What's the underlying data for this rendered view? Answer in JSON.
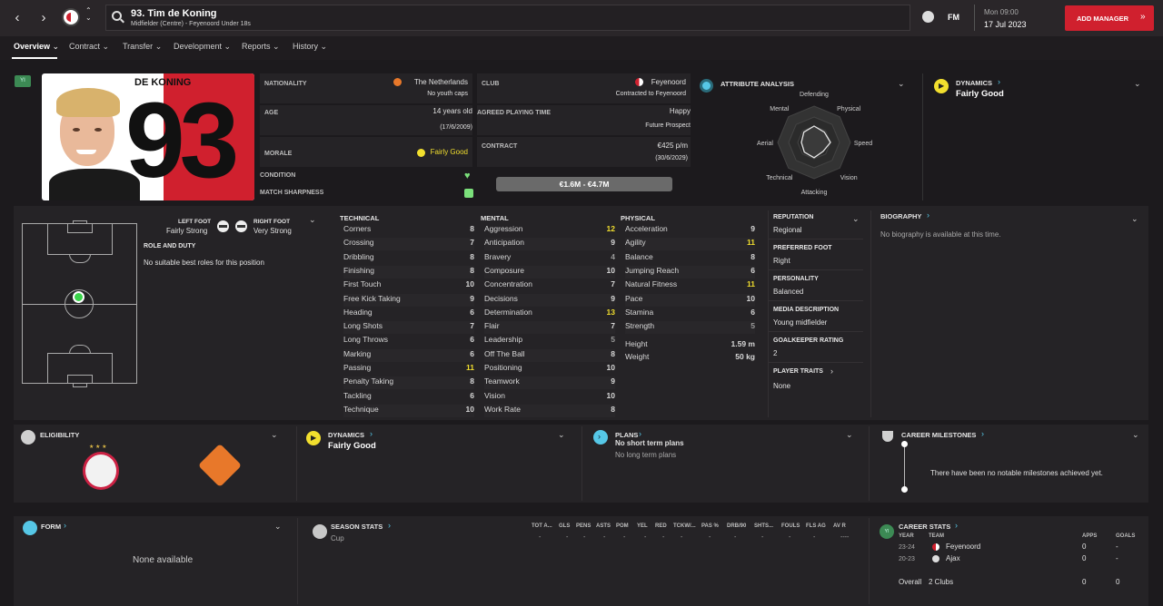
{
  "header": {
    "title": "93. Tim de Koning",
    "subtitle": "Midfielder (Centre) - Feyenoord Under 18s",
    "fm_label": "FM",
    "time": "Mon 09:00",
    "date": "17 Jul 2023",
    "add_manager": "ADD MANAGER"
  },
  "tabs": [
    "Overview",
    "Contract",
    "Transfer",
    "Development",
    "Reports",
    "History"
  ],
  "player": {
    "badge": "YI",
    "shirt_name": "DE KONING",
    "shirt_number": "93",
    "nationality_label": "NATIONALITY",
    "nationality": "The Netherlands",
    "youth_caps": "No youth caps",
    "club_label": "CLUB",
    "club": "Feyenoord",
    "club_status": "Contracted to Feyenoord",
    "age_label": "AGE",
    "age": "14 years old",
    "dob": "(17/6/2009)",
    "apt_label": "AGREED PLAYING TIME",
    "apt_status": "Happy",
    "apt_value": "Future Prospect",
    "morale_label": "MORALE",
    "morale": "Fairly Good",
    "contract_label": "CONTRACT",
    "wage": "€425 p/m",
    "contract_end": "(30/6/2029)",
    "condition_label": "CONDITION",
    "sharpness_label": "MATCH SHARPNESS",
    "value": "€1.6M - €4.7M"
  },
  "attr_analysis": {
    "title": "ATTRIBUTE ANALYSIS",
    "labels": [
      "Defending",
      "Physical",
      "Speed",
      "Vision",
      "Attacking",
      "Technical",
      "Aerial",
      "Mental"
    ],
    "values": [
      0.45,
      0.4,
      0.45,
      0.35,
      0.42,
      0.38,
      0.35,
      0.4
    ]
  },
  "dynamics_top": {
    "label": "DYNAMICS",
    "value": "Fairly Good"
  },
  "feet": {
    "left_label": "LEFT FOOT",
    "left": "Fairly Strong",
    "right_label": "RIGHT FOOT",
    "right": "Very Strong",
    "role_label": "ROLE AND DUTY",
    "role_text": "No suitable best roles for this position"
  },
  "technical": {
    "title": "TECHNICAL",
    "rows": [
      {
        "n": "Corners",
        "v": "8"
      },
      {
        "n": "Crossing",
        "v": "7"
      },
      {
        "n": "Dribbling",
        "v": "8"
      },
      {
        "n": "Finishing",
        "v": "8"
      },
      {
        "n": "First Touch",
        "v": "10"
      },
      {
        "n": "Free Kick Taking",
        "v": "9"
      },
      {
        "n": "Heading",
        "v": "6"
      },
      {
        "n": "Long Shots",
        "v": "7"
      },
      {
        "n": "Long Throws",
        "v": "6"
      },
      {
        "n": "Marking",
        "v": "6"
      },
      {
        "n": "Passing",
        "v": "11"
      },
      {
        "n": "Penalty Taking",
        "v": "8"
      },
      {
        "n": "Tackling",
        "v": "6"
      },
      {
        "n": "Technique",
        "v": "10"
      }
    ]
  },
  "mental": {
    "title": "MENTAL",
    "rows": [
      {
        "n": "Aggression",
        "v": "12"
      },
      {
        "n": "Anticipation",
        "v": "9"
      },
      {
        "n": "Bravery",
        "v": "4"
      },
      {
        "n": "Composure",
        "v": "10"
      },
      {
        "n": "Concentration",
        "v": "7"
      },
      {
        "n": "Decisions",
        "v": "9"
      },
      {
        "n": "Determination",
        "v": "13"
      },
      {
        "n": "Flair",
        "v": "7"
      },
      {
        "n": "Leadership",
        "v": "5"
      },
      {
        "n": "Off The Ball",
        "v": "8"
      },
      {
        "n": "Positioning",
        "v": "10"
      },
      {
        "n": "Teamwork",
        "v": "9"
      },
      {
        "n": "Vision",
        "v": "10"
      },
      {
        "n": "Work Rate",
        "v": "8"
      }
    ]
  },
  "physical": {
    "title": "PHYSICAL",
    "rows": [
      {
        "n": "Acceleration",
        "v": "9"
      },
      {
        "n": "Agility",
        "v": "11"
      },
      {
        "n": "Balance",
        "v": "8"
      },
      {
        "n": "Jumping Reach",
        "v": "6"
      },
      {
        "n": "Natural Fitness",
        "v": "11"
      },
      {
        "n": "Pace",
        "v": "10"
      },
      {
        "n": "Stamina",
        "v": "6"
      },
      {
        "n": "Strength",
        "v": "5"
      }
    ],
    "height_label": "Height",
    "height": "1.59 m",
    "weight_label": "Weight",
    "weight": "50 kg"
  },
  "info": {
    "reputation_label": "REPUTATION",
    "reputation": "Regional",
    "foot_label": "PREFERRED FOOT",
    "foot": "Right",
    "personality_label": "PERSONALITY",
    "personality": "Balanced",
    "media_label": "MEDIA DESCRIPTION",
    "media": "Young midfielder",
    "gk_label": "GOALKEEPER RATING",
    "gk": "2",
    "traits_label": "PLAYER TRAITS",
    "traits": "None"
  },
  "biography": {
    "label": "BIOGRAPHY",
    "text": "No biography is available at this time."
  },
  "eligibility": {
    "label": "ELIGIBILITY"
  },
  "dynamics_bottom": {
    "label": "DYNAMICS",
    "value": "Fairly Good"
  },
  "plans": {
    "label": "PLANS",
    "short": "No short term plans",
    "long": "No long term plans"
  },
  "milestones": {
    "label": "CAREER MILESTONES",
    "text": "There have been no notable milestones achieved yet."
  },
  "form": {
    "label": "FORM",
    "text": "None available"
  },
  "season_stats": {
    "label": "SEASON STATS",
    "competition": "Cup",
    "cols": [
      "TOT A...",
      "GLS",
      "PENS",
      "ASTS",
      "POM",
      "YEL",
      "RED",
      "TCKW/...",
      "PAS %",
      "DRB/90",
      "SHTS...",
      "FOULS",
      "FLS AG",
      "AV R"
    ],
    "vals": [
      "-",
      "-",
      "-",
      "-",
      "-",
      "-",
      "-",
      "-",
      "-",
      "-",
      "-",
      "-",
      "-",
      "----"
    ]
  },
  "career_stats": {
    "label": "CAREER STATS",
    "year_h": "YEAR",
    "team_h": "TEAM",
    "apps_h": "APPS",
    "goals_h": "GOALS",
    "rows": [
      {
        "year": "23-24",
        "team": "Feyenoord",
        "apps": "0",
        "goals": "-"
      },
      {
        "year": "20-23",
        "team": "Ajax",
        "apps": "0",
        "goals": "-"
      }
    ],
    "overall_label": "Overall",
    "overall_team": "2 Clubs",
    "overall_apps": "0",
    "overall_goals": "0"
  },
  "colors": {
    "accent": "#d0202e",
    "cyan": "#56c7e6",
    "highlight": "#f2df2e",
    "bg": "#1c1a1d",
    "panel": "#252326"
  }
}
